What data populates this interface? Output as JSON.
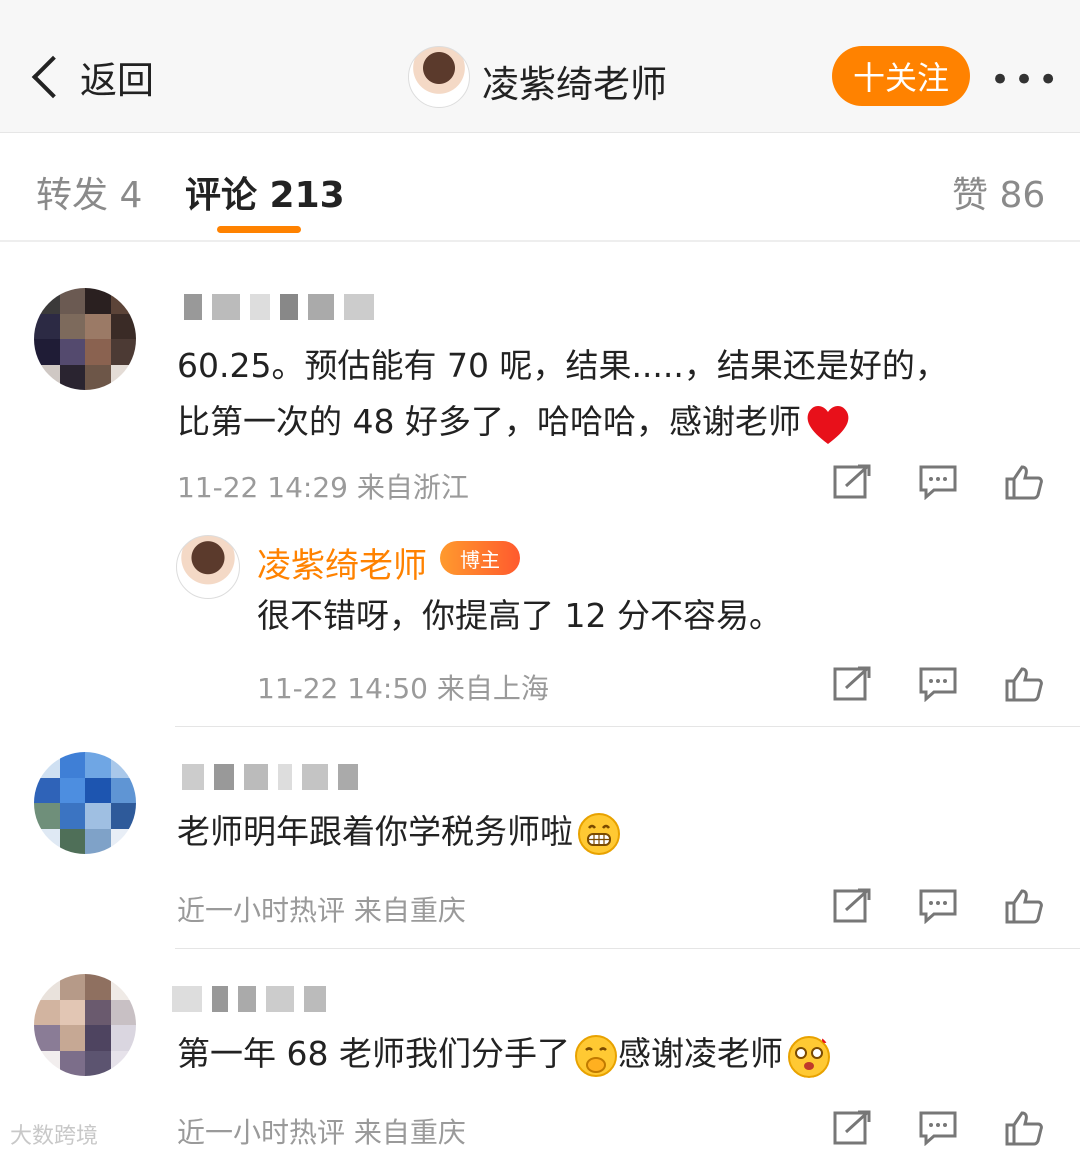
{
  "header": {
    "back_label": "返回",
    "title": "凌紫绮老师",
    "follow_label": "十关注",
    "more_label": "•••"
  },
  "tabs": {
    "reposts": "转发 4",
    "comments": "评论 213",
    "likes": "赞 86"
  },
  "colors": {
    "accent": "#ff8200",
    "text": "#222222",
    "meta": "#9a9a9a"
  },
  "comments": [
    {
      "line1": "60.25。预估能有 70 呢，结果.....，结果还是好的，",
      "line2": "比第一次的 48 好多了，哈哈哈，感谢老师",
      "emoji": "red-heart",
      "meta": "11-22 14:29  来自浙江"
    },
    {
      "text": "老师明年跟着你学税务师啦",
      "emoji": "grin",
      "meta": "近一小时热评  来自重庆"
    },
    {
      "text_a": "第一年 68  老师我们分手了",
      "emoji_a": "covering-mouth",
      "text_b": "感谢凌老师",
      "emoji_b": "star-struck",
      "meta": "近一小时热评  来自重庆"
    }
  ],
  "reply": {
    "name": "凌紫绮老师",
    "badge": "博主",
    "text": "很不错呀，你提高了 12 分不容易。",
    "meta": "11-22 14:50  来自上海"
  },
  "watermark": "大数跨境"
}
